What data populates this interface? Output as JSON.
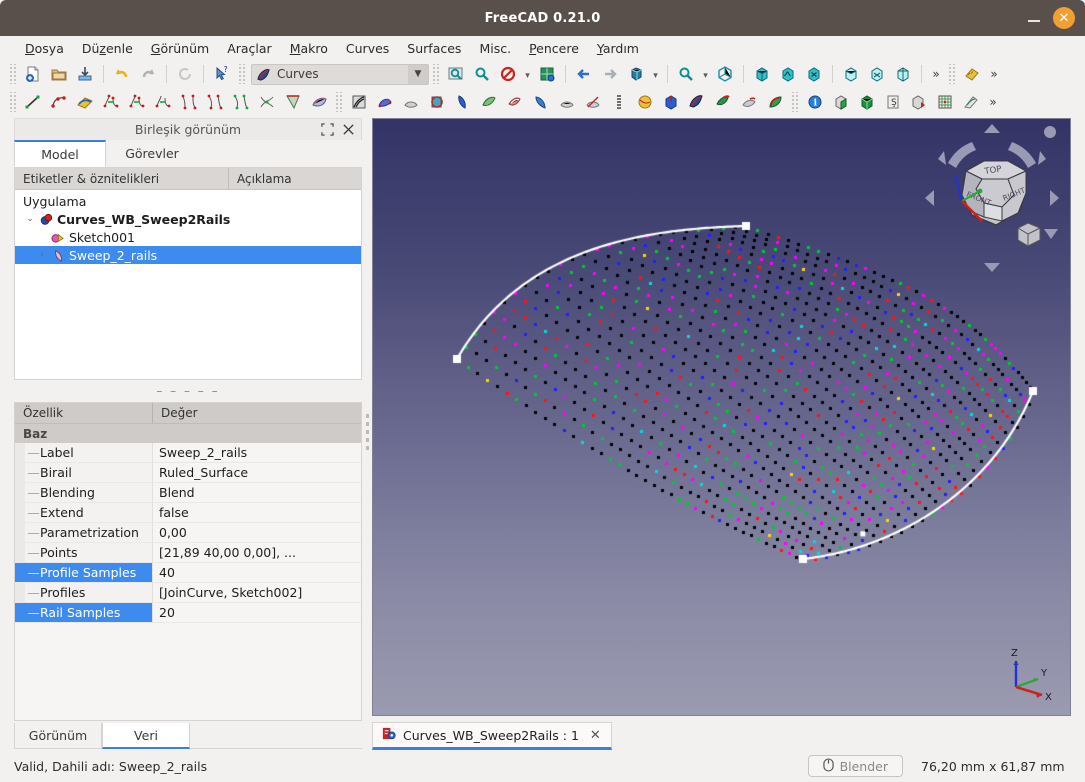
{
  "window": {
    "title": "FreeCAD 0.21.0",
    "minimize_label": "–",
    "close_label": "✕"
  },
  "menubar": {
    "items": [
      {
        "label": "Dosya",
        "mnemonic": "D"
      },
      {
        "label": "Düzenle",
        "mnemonic": "z"
      },
      {
        "label": "Görünüm",
        "mnemonic": "G"
      },
      {
        "label": "Araçlar",
        "mnemonic": ""
      },
      {
        "label": "Makro",
        "mnemonic": "M"
      },
      {
        "label": "Curves",
        "mnemonic": ""
      },
      {
        "label": "Surfaces",
        "mnemonic": ""
      },
      {
        "label": "Misc.",
        "mnemonic": ""
      },
      {
        "label": "Pencere",
        "mnemonic": "P"
      },
      {
        "label": "Yardım",
        "mnemonic": "Y"
      }
    ]
  },
  "toolbar": {
    "workbench_selected": "Curves",
    "workbench_icon": "curves-workbench-icon",
    "overflow_label": "»",
    "row1_icons": [
      "new-document-icon",
      "open-document-icon",
      "save-document-icon",
      "undo-icon",
      "redo-icon",
      "refresh-icon",
      "whats-this-icon"
    ],
    "row1_view_icons": [
      "fit-all-icon",
      "fit-selection-icon",
      "draw-style-icon",
      "isometric-icon",
      "back-arrow-icon",
      "forward-arrow-icon",
      "std-view-icon",
      "zoom-icon",
      "axonometric-icon",
      "front-view-icon",
      "top-view-icon",
      "right-view-icon",
      "rear-view-icon",
      "bottom-view-icon",
      "left-view-icon",
      "measure-icon"
    ],
    "row2_icons": [
      "line-icon",
      "bspline-icon",
      "editable-spline-icon",
      "join-curve-icon",
      "split-curve-icon",
      "discretize-icon",
      "approximate-icon",
      "interpolate-icon",
      "parametric-blend-icon",
      "curve-extend-icon",
      "curve-on-surface-icon",
      "isocurve-icon",
      "zebra-icon",
      "sweep2rails-icon",
      "gordon-surface-icon",
      "profile-support-icon",
      "flatten-face-icon",
      "pipeshell-icon",
      "pipeshell-profile-icon",
      "segment-surface-icon",
      "blend-surface-icon",
      "coil-icon",
      "sphere-icon",
      "solid-icon",
      "curves-icon",
      "paste-icon",
      "blend-solid-icon",
      "melon-icon",
      "info-icon",
      "green-box-icon",
      "cube-icon",
      "clipboard-icon",
      "export-cube-icon",
      "grid-icon",
      "sketch-mirror-icon"
    ]
  },
  "left_dock": {
    "title": "Birleşik görünüm",
    "float_icon": "undock-icon",
    "close_icon": "close-icon",
    "tabs": [
      {
        "label": "Model",
        "active": true
      },
      {
        "label": "Görevler",
        "active": false
      }
    ],
    "tree": {
      "columns": [
        "Etiketler & öznitelikleri",
        "Açıklama"
      ],
      "rows": [
        {
          "label": "Uygulama",
          "depth": 0,
          "bold": false,
          "selected": false,
          "expander": "",
          "icon": ""
        },
        {
          "label": "Curves_WB_Sweep2Rails",
          "depth": 1,
          "bold": true,
          "selected": false,
          "expander": "⌄",
          "icon": "document-icon"
        },
        {
          "label": "Sketch001",
          "depth": 2,
          "bold": false,
          "selected": false,
          "expander": "",
          "icon": "sketch-icon"
        },
        {
          "label": "Sweep_2_rails",
          "depth": 2,
          "bold": false,
          "selected": true,
          "expander": "›",
          "icon": "surface-icon"
        }
      ]
    },
    "separator": "– – – – –",
    "properties": {
      "columns": [
        "Özellik",
        "Değer"
      ],
      "group": "Baz",
      "rows": [
        {
          "name": "Label",
          "value": "Sweep_2_rails",
          "highlight": false
        },
        {
          "name": "Birail",
          "value": "Ruled_Surface",
          "highlight": false
        },
        {
          "name": "Blending",
          "value": "Blend",
          "highlight": false
        },
        {
          "name": "Extend",
          "value": "false",
          "highlight": false
        },
        {
          "name": "Parametrization",
          "value": "0,00",
          "highlight": false
        },
        {
          "name": "Points",
          "value": "[21,89 40,00 0,00], ...",
          "highlight": false
        },
        {
          "name": "Profile Samples",
          "value": "40",
          "highlight": true
        },
        {
          "name": "Profiles",
          "value": "[JoinCurve, Sketch002]",
          "highlight": false
        },
        {
          "name": "Rail Samples",
          "value": "20",
          "highlight": true
        }
      ]
    },
    "bottom_tabs": [
      {
        "label": "Görünüm",
        "active": false
      },
      {
        "label": "Veri",
        "active": true
      }
    ]
  },
  "view": {
    "document_tab": {
      "label": "Curves_WB_Sweep2Rails : 1",
      "icon": "freecad-document-icon",
      "close_label": "✕"
    },
    "navcube": {
      "faces": [
        "TOP",
        "FRONT",
        "RIGHT"
      ],
      "arrow_up": "nav-arrow-up",
      "arrow_down": "nav-arrow-down",
      "arrow_left": "nav-arrow-left",
      "arrow_right": "nav-arrow-right",
      "rotate_left": "nav-rotate-left",
      "rotate_right": "nav-rotate-right",
      "corner_dot": "nav-corner-dot",
      "home_cube": "nav-home-cube"
    },
    "axis_labels": [
      "Z",
      "Y",
      "X"
    ],
    "axis_colors": {
      "x": "#cc2222",
      "y": "#22aa33",
      "z": "#2233cc"
    },
    "background": {
      "top": "#333366",
      "bottom": "#9a9ab0"
    },
    "point_colors": [
      "#000000",
      "#00c832",
      "#ff00ff",
      "#2020ff",
      "#ff1414",
      "#00dcdc",
      "#ffd700"
    ],
    "curve_color": "#ffffff",
    "profile_samples": 40,
    "rail_samples": 20
  },
  "statusbar": {
    "message": "Valid, Dahili adı: Sweep_2_rails",
    "nav_style": "Blender",
    "nav_icon": "mouse-icon",
    "dimensions": "76,20 mm x 61,87 mm"
  }
}
